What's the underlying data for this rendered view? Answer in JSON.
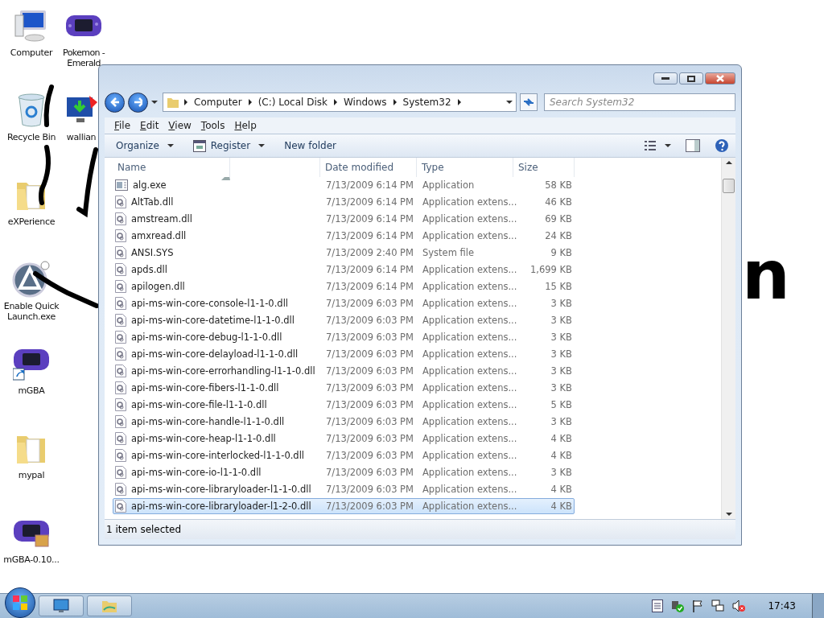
{
  "desktop": {
    "icons": [
      {
        "label": "Computer",
        "kind": "computer"
      },
      {
        "label": "Pokemon -\nEmerald",
        "kind": "gba"
      },
      {
        "label": "Recycle Bin",
        "kind": "recycle"
      },
      {
        "label": "wallian",
        "kind": "download"
      },
      {
        "label": "eXPerience",
        "kind": "folder"
      },
      {
        "label": "Enable Quick\nLaunch.exe",
        "kind": "app"
      },
      {
        "label": "mGBA",
        "kind": "gba-shortcut"
      },
      {
        "label": "mypal",
        "kind": "folder"
      },
      {
        "label": "mGBA-0.10...",
        "kind": "gba-zip"
      }
    ],
    "handwriting": "n"
  },
  "window": {
    "address": {
      "crumbs": [
        "Computer",
        "(C:) Local Disk",
        "Windows",
        "System32"
      ]
    },
    "search": {
      "placeholder": "Search System32"
    },
    "menu": [
      "File",
      "Edit",
      "View",
      "Tools",
      "Help"
    ],
    "toolbar": [
      {
        "label": "Organize",
        "kind": "menu"
      },
      {
        "label": "Register",
        "kind": "icon-menu"
      },
      {
        "label": "New folder",
        "kind": "plain"
      }
    ],
    "columns": [
      "Name",
      "Date modified",
      "Type",
      "Size"
    ],
    "rows": [
      {
        "name": "alg.exe",
        "date": "7/13/2009 6:14 PM",
        "type": "Application",
        "size": "58 KB",
        "kind": "exe",
        "selected": false
      },
      {
        "name": "AltTab.dll",
        "date": "7/13/2009 6:14 PM",
        "type": "Application extens...",
        "size": "46 KB",
        "kind": "dll",
        "selected": false
      },
      {
        "name": "amstream.dll",
        "date": "7/13/2009 6:14 PM",
        "type": "Application extens...",
        "size": "69 KB",
        "kind": "dll",
        "selected": false
      },
      {
        "name": "amxread.dll",
        "date": "7/13/2009 6:14 PM",
        "type": "Application extens...",
        "size": "24 KB",
        "kind": "dll",
        "selected": false
      },
      {
        "name": "ANSI.SYS",
        "date": "7/13/2009 2:40 PM",
        "type": "System file",
        "size": "9 KB",
        "kind": "dll",
        "selected": false
      },
      {
        "name": "apds.dll",
        "date": "7/13/2009 6:14 PM",
        "type": "Application extens...",
        "size": "1,699 KB",
        "kind": "dll",
        "selected": false
      },
      {
        "name": "apilogen.dll",
        "date": "7/13/2009 6:14 PM",
        "type": "Application extens...",
        "size": "15 KB",
        "kind": "dll",
        "selected": false
      },
      {
        "name": "api-ms-win-core-console-l1-1-0.dll",
        "date": "7/13/2009 6:03 PM",
        "type": "Application extens...",
        "size": "3 KB",
        "kind": "dll",
        "selected": false
      },
      {
        "name": "api-ms-win-core-datetime-l1-1-0.dll",
        "date": "7/13/2009 6:03 PM",
        "type": "Application extens...",
        "size": "3 KB",
        "kind": "dll",
        "selected": false
      },
      {
        "name": "api-ms-win-core-debug-l1-1-0.dll",
        "date": "7/13/2009 6:03 PM",
        "type": "Application extens...",
        "size": "3 KB",
        "kind": "dll",
        "selected": false
      },
      {
        "name": "api-ms-win-core-delayload-l1-1-0.dll",
        "date": "7/13/2009 6:03 PM",
        "type": "Application extens...",
        "size": "3 KB",
        "kind": "dll",
        "selected": false
      },
      {
        "name": "api-ms-win-core-errorhandling-l1-1-0.dll",
        "date": "7/13/2009 6:03 PM",
        "type": "Application extens...",
        "size": "3 KB",
        "kind": "dll",
        "selected": false
      },
      {
        "name": "api-ms-win-core-fibers-l1-1-0.dll",
        "date": "7/13/2009 6:03 PM",
        "type": "Application extens...",
        "size": "3 KB",
        "kind": "dll",
        "selected": false
      },
      {
        "name": "api-ms-win-core-file-l1-1-0.dll",
        "date": "7/13/2009 6:03 PM",
        "type": "Application extens...",
        "size": "5 KB",
        "kind": "dll",
        "selected": false
      },
      {
        "name": "api-ms-win-core-handle-l1-1-0.dll",
        "date": "7/13/2009 6:03 PM",
        "type": "Application extens...",
        "size": "3 KB",
        "kind": "dll",
        "selected": false
      },
      {
        "name": "api-ms-win-core-heap-l1-1-0.dll",
        "date": "7/13/2009 6:03 PM",
        "type": "Application extens...",
        "size": "4 KB",
        "kind": "dll",
        "selected": false
      },
      {
        "name": "api-ms-win-core-interlocked-l1-1-0.dll",
        "date": "7/13/2009 6:03 PM",
        "type": "Application extens...",
        "size": "4 KB",
        "kind": "dll",
        "selected": false
      },
      {
        "name": "api-ms-win-core-io-l1-1-0.dll",
        "date": "7/13/2009 6:03 PM",
        "type": "Application extens...",
        "size": "3 KB",
        "kind": "dll",
        "selected": false
      },
      {
        "name": "api-ms-win-core-libraryloader-l1-1-0.dll",
        "date": "7/13/2009 6:03 PM",
        "type": "Application extens...",
        "size": "4 KB",
        "kind": "dll",
        "selected": false
      },
      {
        "name": "api-ms-win-core-libraryloader-l1-2-0.dll",
        "date": "7/13/2009 6:03 PM",
        "type": "Application extens...",
        "size": "4 KB",
        "kind": "dll",
        "selected": true
      }
    ],
    "status_bar": "1 item selected"
  },
  "taskbar": {
    "clock": "17:43"
  }
}
